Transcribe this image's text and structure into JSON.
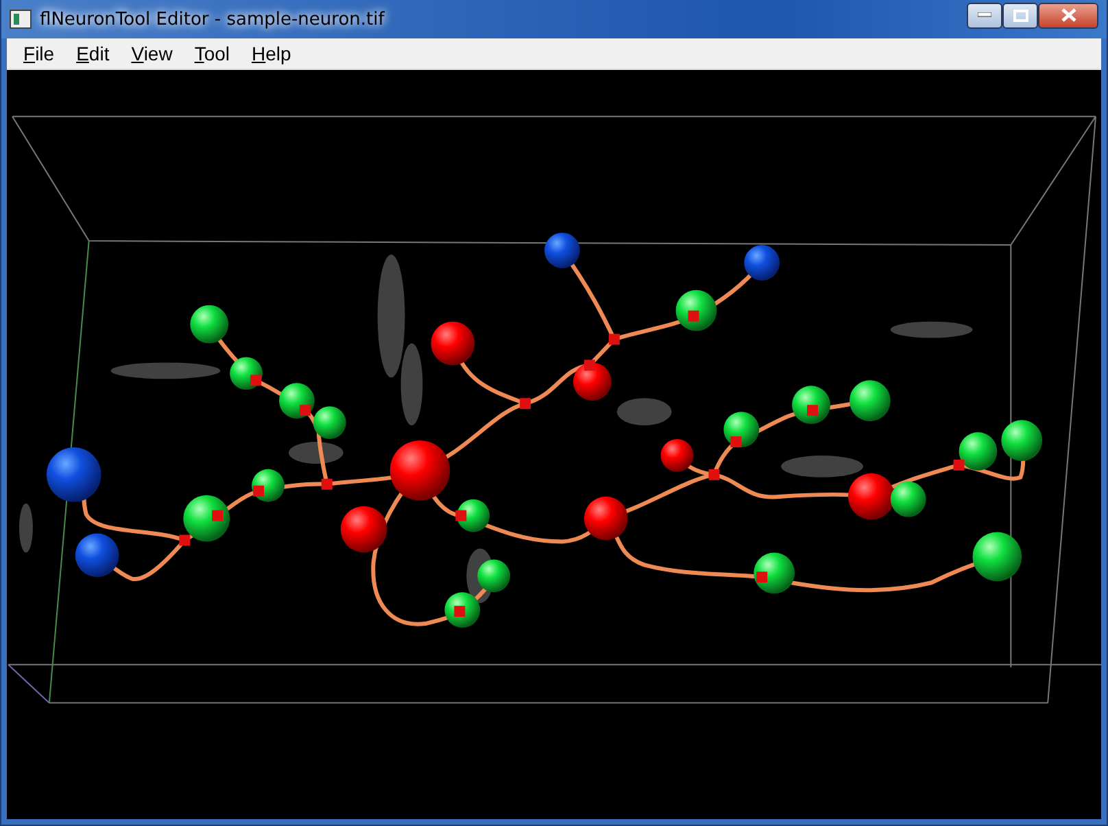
{
  "window": {
    "title": "flNeuronTool Editor - sample-neuron.tif"
  },
  "menu": [
    {
      "label": "File"
    },
    {
      "label": "Edit"
    },
    {
      "label": "View"
    },
    {
      "label": "Tool"
    },
    {
      "label": "Help"
    }
  ]
}
